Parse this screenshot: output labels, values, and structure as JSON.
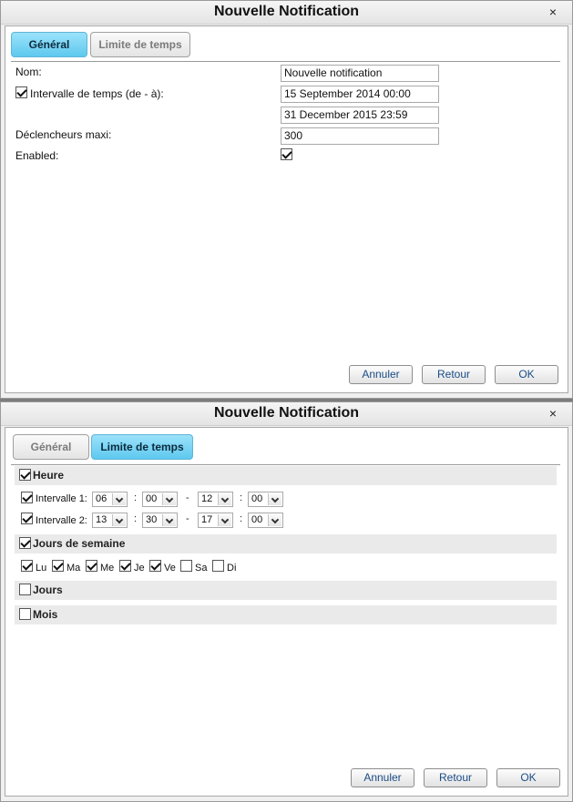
{
  "dialog1": {
    "title": "Nouvelle Notification",
    "close_glyph": "×",
    "tabs": [
      {
        "label": "Général",
        "active": true
      },
      {
        "label": "Limite de temps",
        "active": false
      }
    ],
    "name_label": "Nom:",
    "name_value": "Nouvelle notification",
    "interval_label": "Intervalle de temps (de - à):",
    "interval_checked": true,
    "interval_from": "15 September 2014 00:00",
    "interval_to": "31 December 2015 23:59",
    "max_triggers_label": "Déclencheurs maxi:",
    "max_triggers_value": "300",
    "enabled_label": "Enabled:",
    "enabled_checked": true,
    "buttons": {
      "cancel": "Annuler",
      "back": "Retour",
      "ok": "OK"
    }
  },
  "dialog2": {
    "title": "Nouvelle Notification",
    "close_glyph": "×",
    "tabs": [
      {
        "label": "Général",
        "active": false
      },
      {
        "label": "Limite de temps",
        "active": true
      }
    ],
    "heure": {
      "title": "Heure",
      "checked": true,
      "intervals": [
        {
          "label": "Intervalle 1:",
          "checked": true,
          "from_h": "06",
          "from_m": "00",
          "to_h": "12",
          "to_m": "00"
        },
        {
          "label": "Intervalle 2:",
          "checked": true,
          "from_h": "13",
          "from_m": "30",
          "to_h": "17",
          "to_m": "00"
        }
      ],
      "colon": ":",
      "dash": "-"
    },
    "jours_semaine": {
      "title": "Jours de semaine",
      "checked": true,
      "days": [
        {
          "label": "Lu",
          "checked": true
        },
        {
          "label": "Ma",
          "checked": true
        },
        {
          "label": "Me",
          "checked": true
        },
        {
          "label": "Je",
          "checked": true
        },
        {
          "label": "Ve",
          "checked": true
        },
        {
          "label": "Sa",
          "checked": false
        },
        {
          "label": "Di",
          "checked": false
        }
      ]
    },
    "jours": {
      "title": "Jours",
      "checked": false
    },
    "mois": {
      "title": "Mois",
      "checked": false
    },
    "buttons": {
      "cancel": "Annuler",
      "back": "Retour",
      "ok": "OK"
    }
  }
}
